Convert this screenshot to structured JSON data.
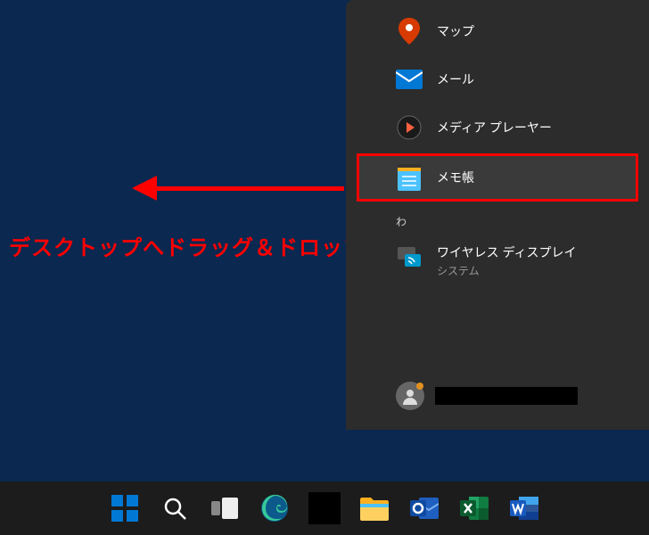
{
  "start_menu": {
    "apps": [
      {
        "label": "マップ",
        "icon": "map-pin-icon",
        "color": "#d83b01"
      },
      {
        "label": "メール",
        "icon": "mail-icon",
        "color": "#0078d4"
      },
      {
        "label": "メディア プレーヤー",
        "icon": "media-player-icon",
        "color": "#d13438"
      },
      {
        "label": "メモ帳",
        "icon": "notepad-icon",
        "color": "#4cc2ff",
        "highlighted": true
      }
    ],
    "section_header": "わ",
    "sub_item": {
      "title": "ワイヤレス ディスプレイ",
      "subtitle": "システム",
      "icon": "wireless-display-icon"
    }
  },
  "annotation": {
    "text": "デスクトップへドラッグ＆ドロップする"
  },
  "taskbar": {
    "items": [
      {
        "name": "start-button",
        "icon": "windows-logo"
      },
      {
        "name": "search-button",
        "icon": "search"
      },
      {
        "name": "task-view-button",
        "icon": "task-view"
      },
      {
        "name": "edge-button",
        "icon": "edge"
      },
      {
        "name": "app-button",
        "icon": "placeholder"
      },
      {
        "name": "file-explorer-button",
        "icon": "file-explorer"
      },
      {
        "name": "outlook-button",
        "icon": "outlook"
      },
      {
        "name": "excel-button",
        "icon": "excel"
      },
      {
        "name": "word-button",
        "icon": "word"
      }
    ]
  }
}
